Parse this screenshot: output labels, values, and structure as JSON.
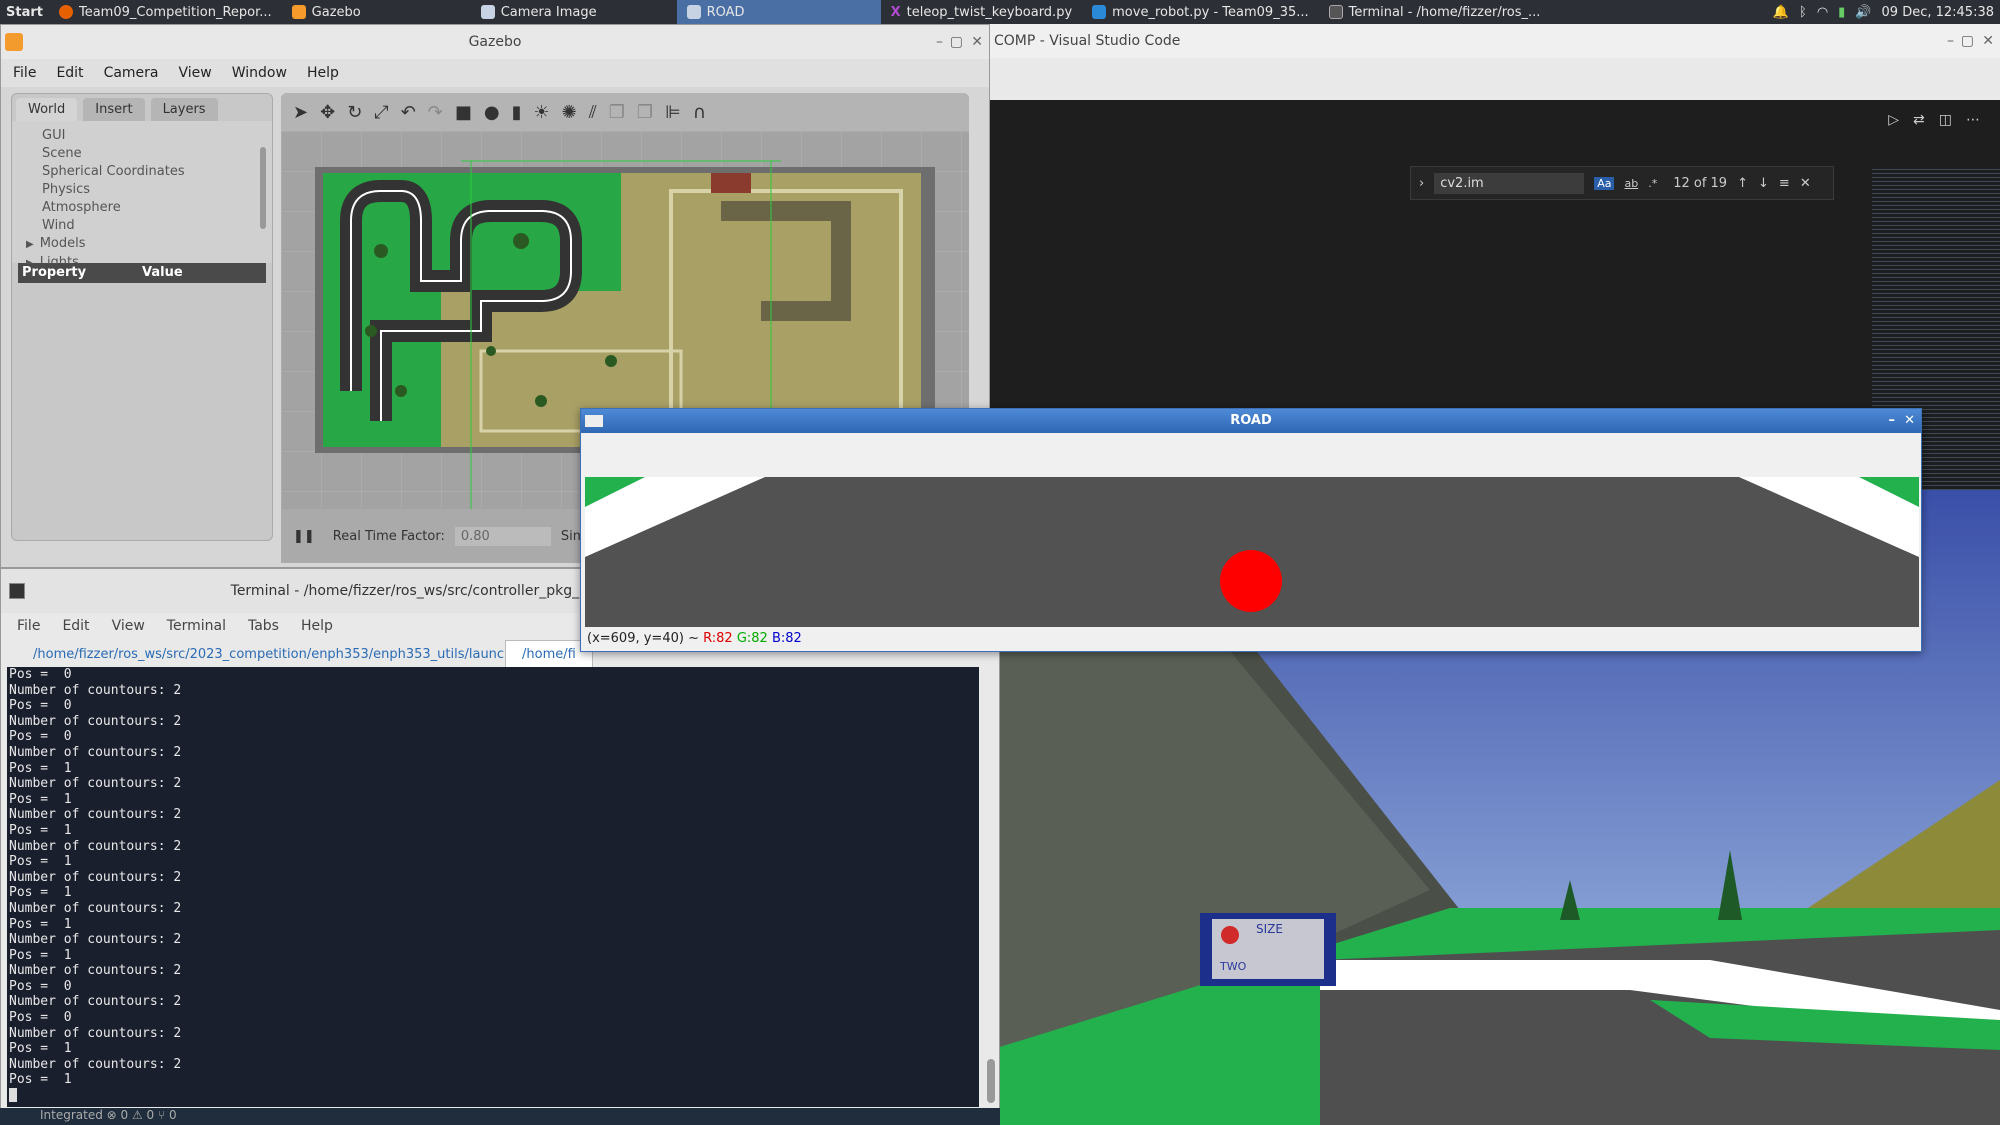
{
  "taskbar": {
    "start": "Start",
    "tasks": [
      {
        "label": "Team09_Competition_Repor...",
        "icon": "firefox-icon",
        "active": false
      },
      {
        "label": "Gazebo",
        "icon": "gazebo-icon",
        "active": false
      },
      {
        "label": "Camera Image",
        "icon": "window-icon",
        "active": false
      },
      {
        "label": "ROAD",
        "icon": "window-icon",
        "active": true
      },
      {
        "label": "teleop_twist_keyboard.py",
        "icon": "x-icon",
        "active": false
      },
      {
        "label": "move_robot.py - Team09_35...",
        "icon": "vscode-icon",
        "active": false
      },
      {
        "label": "Terminal - /home/fizzer/ros_...",
        "icon": "terminal-icon",
        "active": false
      }
    ],
    "clock": "09 Dec, 12:45:38"
  },
  "gazebo": {
    "title": "Gazebo",
    "menu": [
      "File",
      "Edit",
      "Camera",
      "View",
      "Window",
      "Help"
    ],
    "tabs": [
      "World",
      "Insert",
      "Layers"
    ],
    "tree": [
      "GUI",
      "Scene",
      "Spherical Coordinates",
      "Physics",
      "Atmosphere",
      "Wind",
      "Models",
      "Lights"
    ],
    "property_header": "Property",
    "value_header": "Value",
    "real_time_factor_label": "Real Time Factor:",
    "real_time_factor": "0.80",
    "sim_time_label": "Sim Ti"
  },
  "vscode": {
    "title": "COMP - Visual Studio Code",
    "find_query": "cv2.im",
    "find_count": "12 of 19",
    "find_opts": [
      "Aa",
      "ab",
      ".*"
    ]
  },
  "terminal": {
    "title": "Terminal - /home/fizzer/ros_ws/src/controller_pkg_repo/Team09_353_COMP/la",
    "menu": [
      "File",
      "Edit",
      "View",
      "Terminal",
      "Tabs",
      "Help"
    ],
    "tab1": "/home/fizzer/ros_ws/src/2023_competition/enph353/enph353_utils/launc...",
    "tab2": "/home/fi",
    "lines": [
      "Pos =  0",
      "Number of countours: 2",
      "Pos =  0",
      "Number of countours: 2",
      "Pos =  0",
      "Number of countours: 2",
      "Pos =  1",
      "Number of countours: 2",
      "Pos =  1",
      "Number of countours: 2",
      "Pos =  1",
      "Number of countours: 2",
      "Pos =  1",
      "Number of countours: 2",
      "Pos =  1",
      "Number of countours: 2",
      "Pos =  1",
      "Number of countours: 2",
      "Pos =  1",
      "Number of countours: 2",
      "Pos =  0",
      "Number of countours: 2",
      "Pos =  0",
      "Number of countours: 2",
      "Pos =  1",
      "Number of countours: 2",
      "Pos =  1"
    ]
  },
  "statusbar": {
    "text": "Integrated   ⊗ 0 ⚠ 0   ⑂ 0"
  },
  "road": {
    "title": "ROAD",
    "coords": "(x=609, y=40) ~",
    "r": "R:82",
    "g": "G:82",
    "b": "B:82"
  },
  "sign": {
    "line1": "SIZE",
    "line2": "TWO"
  }
}
